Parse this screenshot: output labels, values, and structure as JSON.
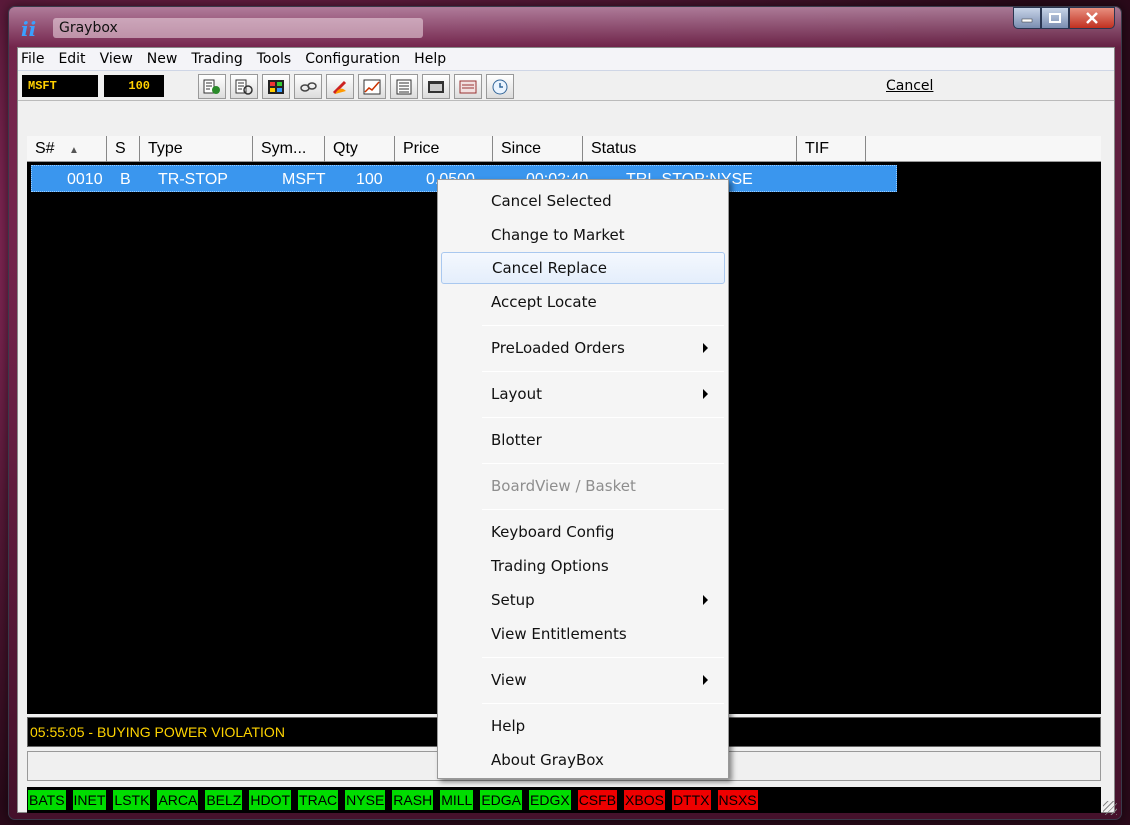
{
  "window": {
    "title": "Graybox",
    "app_icon": "graybox-logo-icon"
  },
  "menubar": [
    {
      "label": "File"
    },
    {
      "label": "Edit"
    },
    {
      "label": "View"
    },
    {
      "label": "New"
    },
    {
      "label": "Trading"
    },
    {
      "label": "Tools"
    },
    {
      "label": "Configuration"
    },
    {
      "label": "Help"
    }
  ],
  "toolbar": {
    "symbol": "MSFT",
    "quantity": "100",
    "cancel_label": "Cancel",
    "icons": [
      "order-entry-icon",
      "multi-order-icon",
      "montage-icon",
      "glasses-icon",
      "flame-icon",
      "chart-icon",
      "list-icon",
      "window-icon",
      "open-orders-icon",
      "clock-icon"
    ]
  },
  "grid": {
    "columns": [
      {
        "label": "S#",
        "sort": "▲"
      },
      {
        "label": "S"
      },
      {
        "label": "Type"
      },
      {
        "label": "Sym..."
      },
      {
        "label": "Qty"
      },
      {
        "label": "Price"
      },
      {
        "label": "Since"
      },
      {
        "label": "Status"
      },
      {
        "label": "TIF"
      },
      {
        "label": ""
      }
    ],
    "rows": [
      {
        "sn": "0010",
        "side": "B",
        "type": "TR-STOP",
        "symbol": "MSFT",
        "qty": "100",
        "price": "0.0500",
        "since": "00:02:40",
        "status": "TRL-STOP:NYSE",
        "tif": ""
      }
    ]
  },
  "status_message": "05:55:05 - BUYING POWER VIOLATION",
  "context_menu": [
    {
      "label": "Cancel Selected"
    },
    {
      "label": "Change to Market"
    },
    {
      "label": "Cancel Replace",
      "highlighted": true
    },
    {
      "label": "Accept Locate"
    },
    {
      "label": "PreLoaded Orders",
      "submenu": true
    },
    {
      "label": "Layout",
      "submenu": true
    },
    {
      "label": "Blotter"
    },
    {
      "label": "BoardView / Basket",
      "disabled": true
    },
    {
      "label": "Keyboard Config"
    },
    {
      "label": "Trading Options"
    },
    {
      "label": "Setup",
      "submenu": true
    },
    {
      "label": "View Entitlements"
    },
    {
      "label": "View",
      "submenu": true
    },
    {
      "label": "Help"
    },
    {
      "label": "About GrayBox"
    }
  ],
  "markets": [
    {
      "name": "BATS",
      "state": "up"
    },
    {
      "name": "INET",
      "state": "up"
    },
    {
      "name": "LSTK",
      "state": "up"
    },
    {
      "name": "ARCA",
      "state": "up"
    },
    {
      "name": "BELZ",
      "state": "up"
    },
    {
      "name": "HDOT",
      "state": "up"
    },
    {
      "name": "TRAC",
      "state": "up"
    },
    {
      "name": "NYSE",
      "state": "up"
    },
    {
      "name": "RASH",
      "state": "up"
    },
    {
      "name": "MILL",
      "state": "up"
    },
    {
      "name": "EDGA",
      "state": "up"
    },
    {
      "name": "EDGX",
      "state": "up"
    },
    {
      "name": "CSFB",
      "state": "down"
    },
    {
      "name": "XBOS",
      "state": "down"
    },
    {
      "name": "DTTX",
      "state": "down"
    },
    {
      "name": "NSXS",
      "state": "down"
    }
  ],
  "colors": {
    "selection": "#3a96ee",
    "status_text": "#ffd400",
    "market_up": "#00dd00",
    "market_down": "#ee0000"
  }
}
